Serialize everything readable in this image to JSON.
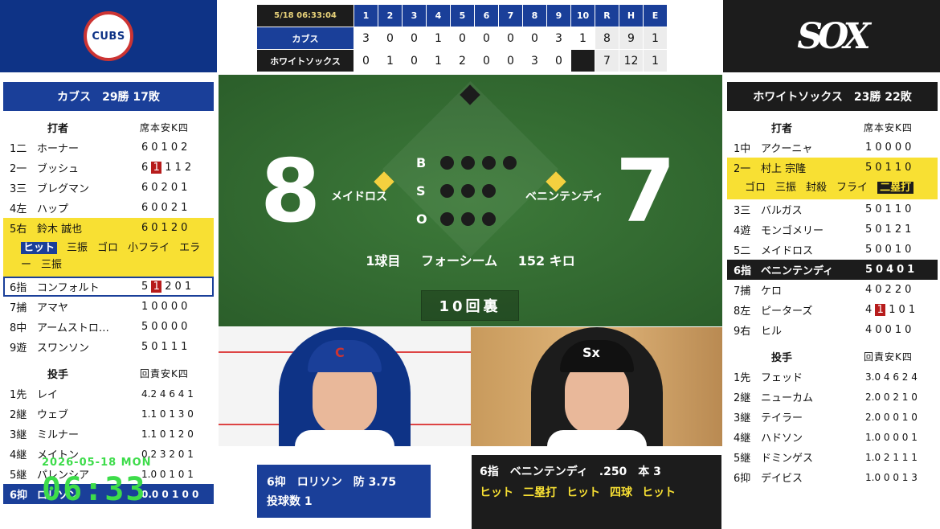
{
  "scoreboard": {
    "timestamp": "5/18 06:33:04",
    "innings": [
      "1",
      "2",
      "3",
      "4",
      "5",
      "6",
      "7",
      "8",
      "9",
      "10"
    ],
    "rhe_headers": [
      "R",
      "H",
      "E"
    ],
    "away": {
      "name": "カブス",
      "innings": [
        "3",
        "0",
        "0",
        "1",
        "0",
        "0",
        "0",
        "0",
        "3",
        "1"
      ],
      "rhe": [
        "8",
        "9",
        "1"
      ]
    },
    "home": {
      "name": "ホワイトソックス",
      "innings": [
        "0",
        "1",
        "0",
        "1",
        "2",
        "0",
        "0",
        "3",
        "0",
        ""
      ],
      "rhe": [
        "7",
        "12",
        "1"
      ]
    }
  },
  "logos": {
    "away": "CUBS",
    "home": "SOX"
  },
  "left_panel": {
    "team_record": "カブス　29勝 17敗",
    "batters_header": "打者",
    "batters_cols": "席本安K四",
    "batters": [
      {
        "pos": "1二",
        "name": "ホーナー",
        "stats": "60102"
      },
      {
        "pos": "2一",
        "name": "ブッシュ",
        "hr": "1",
        "stats": "6112"
      },
      {
        "pos": "3三",
        "name": "ブレグマン",
        "stats": "60201"
      },
      {
        "pos": "4左",
        "name": "ハップ",
        "stats": "60021"
      },
      {
        "pos": "5右",
        "name": "鈴木 誠也",
        "stats": "60120"
      },
      {
        "pos": "6指",
        "name": "コンフォルト",
        "hr": "1",
        "stats": "5201"
      },
      {
        "pos": "7捕",
        "name": "アマヤ",
        "stats": "10000"
      },
      {
        "pos": "8中",
        "name": "アームストロ…",
        "stats": "50000"
      },
      {
        "pos": "9遊",
        "name": "スワンソン",
        "stats": "50111"
      }
    ],
    "suzuki_results": [
      "ヒット",
      "三振",
      "ゴロ",
      "小フライ",
      "エラー",
      "三振"
    ],
    "pitchers_header": "投手",
    "pitchers_cols": "回責安K四",
    "pitchers": [
      {
        "pos": "1先",
        "name": "レイ",
        "stats": "4.2 4 6 4 1"
      },
      {
        "pos": "2継",
        "name": "ウェブ",
        "stats": "1.1 0 1 3 0"
      },
      {
        "pos": "3継",
        "name": "ミルナー",
        "stats": "1.1 0 1 2 0"
      },
      {
        "pos": "4継",
        "name": "メイトン",
        "stats": "0.2 3 2 0 1"
      },
      {
        "pos": "5継",
        "name": "パレンシア",
        "stats": "1.0 0 1 0 1"
      },
      {
        "pos": "6抑",
        "name": "ロリソン",
        "stats": "0.0 0 1 0 0"
      }
    ]
  },
  "right_panel": {
    "team_record": "ホワイトソックス　23勝 22敗",
    "batters_header": "打者",
    "batters_cols": "席本安K四",
    "batters": [
      {
        "pos": "1中",
        "name": "アクーニャ",
        "stats": "10000"
      },
      {
        "pos": "2一",
        "name": "村上 宗隆",
        "stats": "50110"
      },
      {
        "pos": "3三",
        "name": "バルガス",
        "stats": "50110"
      },
      {
        "pos": "4遊",
        "name": "モンゴメリー",
        "stats": "50121"
      },
      {
        "pos": "5二",
        "name": "メイドロス",
        "stats": "50010"
      },
      {
        "pos": "6指",
        "name": "ベニンテンディ",
        "stats": "50401"
      },
      {
        "pos": "7捕",
        "name": "ケロ",
        "stats": "40220"
      },
      {
        "pos": "8左",
        "name": "ピーターズ",
        "hr": "1",
        "stats": "4101"
      },
      {
        "pos": "9右",
        "name": "ヒル",
        "stats": "40010"
      }
    ],
    "murakami_results": [
      "ゴロ",
      "三振",
      "封殺",
      "フライ",
      "二塁打"
    ],
    "pitchers_header": "投手",
    "pitchers_cols": "回責安K四",
    "pitchers": [
      {
        "pos": "1先",
        "name": "フェッド",
        "stats": "3.0 4 6 2 4"
      },
      {
        "pos": "2継",
        "name": "ニューカム",
        "stats": "2.0 0 2 1 0"
      },
      {
        "pos": "3継",
        "name": "テイラー",
        "stats": "2.0 0 0 1 0"
      },
      {
        "pos": "4継",
        "name": "ハドソン",
        "stats": "1.0 0 0 0 1"
      },
      {
        "pos": "5継",
        "name": "ドミンゲス",
        "stats": "1.0 2 1 1 1"
      },
      {
        "pos": "6抑",
        "name": "デイビス",
        "stats": "1.0 0 0 1 3"
      }
    ]
  },
  "field": {
    "score_away": "8",
    "score_home": "7",
    "runner_third": "メイドロス",
    "runner_first": "ベニンテンディ",
    "bso_labels": [
      "B",
      "S",
      "O"
    ],
    "pitch_info": [
      "1球目",
      "フォーシーム",
      "152 キロ"
    ],
    "inning": "10回裏"
  },
  "pitcher_card": {
    "line1": "6抑　ロリソン　防 3.75",
    "line2": "投球数 1"
  },
  "batter_card": {
    "line1": "6指　ベニンテンディ　.250　本 3",
    "results": [
      "ヒット",
      "二塁打",
      "ヒット",
      "四球",
      "ヒット"
    ]
  },
  "clock": {
    "date": "2026-05-18 MON",
    "time": "06:33"
  },
  "colors": {
    "cubs_blue": "#1a3f99",
    "sox_black": "#1c1c1c",
    "highlight_yellow": "#f8e033",
    "field_green": "#2f6a2e",
    "clock_green": "#3ddc4a"
  }
}
